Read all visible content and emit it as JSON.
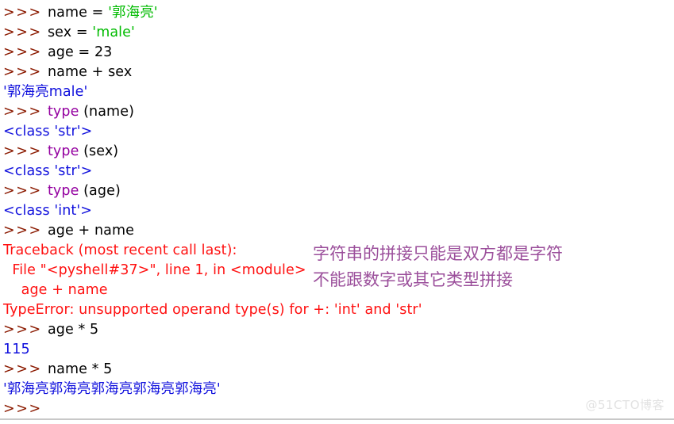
{
  "shell": {
    "app": "Python IDLE Shell",
    "prompt": ">>> ",
    "lines": [
      {
        "id": "l1",
        "kind": "input",
        "prompt": ">>> ",
        "parts": [
          {
            "t": "name = ",
            "c": "plain"
          },
          {
            "t": "'郭海亮'",
            "c": "str"
          }
        ]
      },
      {
        "id": "l2",
        "kind": "input",
        "prompt": ">>> ",
        "parts": [
          {
            "t": "sex = ",
            "c": "plain"
          },
          {
            "t": "'male'",
            "c": "str"
          }
        ]
      },
      {
        "id": "l3",
        "kind": "input",
        "prompt": ">>> ",
        "parts": [
          {
            "t": "age = 23",
            "c": "plain"
          }
        ]
      },
      {
        "id": "l4",
        "kind": "input",
        "prompt": ">>> ",
        "parts": [
          {
            "t": "name + sex",
            "c": "plain"
          }
        ]
      },
      {
        "id": "l5",
        "kind": "output",
        "prompt": "",
        "parts": [
          {
            "t": "'郭海亮male'",
            "c": "out"
          }
        ]
      },
      {
        "id": "l6",
        "kind": "input",
        "prompt": ">>> ",
        "parts": [
          {
            "t": "type",
            "c": "kw"
          },
          {
            "t": " (name)",
            "c": "plain"
          }
        ]
      },
      {
        "id": "l7",
        "kind": "output",
        "prompt": "",
        "parts": [
          {
            "t": "<class 'str'>",
            "c": "out"
          }
        ]
      },
      {
        "id": "l8",
        "kind": "input",
        "prompt": ">>> ",
        "parts": [
          {
            "t": "type",
            "c": "kw"
          },
          {
            "t": " (sex)",
            "c": "plain"
          }
        ]
      },
      {
        "id": "l9",
        "kind": "output",
        "prompt": "",
        "parts": [
          {
            "t": "<class 'str'>",
            "c": "out"
          }
        ]
      },
      {
        "id": "l10",
        "kind": "input",
        "prompt": ">>> ",
        "parts": [
          {
            "t": "type",
            "c": "kw"
          },
          {
            "t": " (age)",
            "c": "plain"
          }
        ]
      },
      {
        "id": "l11",
        "kind": "output",
        "prompt": "",
        "parts": [
          {
            "t": "<class 'int'>",
            "c": "out"
          }
        ]
      },
      {
        "id": "l12",
        "kind": "input",
        "prompt": ">>> ",
        "parts": [
          {
            "t": "age + name",
            "c": "plain"
          }
        ]
      },
      {
        "id": "l13",
        "kind": "error",
        "prompt": "",
        "parts": [
          {
            "t": "Traceback (most recent call last):",
            "c": "err"
          }
        ]
      },
      {
        "id": "l14",
        "kind": "error",
        "prompt": "",
        "parts": [
          {
            "t": "  File \"<pyshell#37>\", line 1, in <module>",
            "c": "err"
          }
        ]
      },
      {
        "id": "l15",
        "kind": "error",
        "prompt": "",
        "parts": [
          {
            "t": "    age + name",
            "c": "err"
          }
        ]
      },
      {
        "id": "l16",
        "kind": "error",
        "prompt": "",
        "parts": [
          {
            "t": "TypeError: unsupported operand type(s) for +: 'int' and 'str'",
            "c": "err"
          }
        ]
      },
      {
        "id": "l17",
        "kind": "input",
        "prompt": ">>> ",
        "parts": [
          {
            "t": "age * 5",
            "c": "plain"
          }
        ]
      },
      {
        "id": "l18",
        "kind": "output",
        "prompt": "",
        "parts": [
          {
            "t": "115",
            "c": "out"
          }
        ]
      },
      {
        "id": "l19",
        "kind": "input",
        "prompt": ">>> ",
        "parts": [
          {
            "t": "name * 5",
            "c": "plain"
          }
        ]
      },
      {
        "id": "l20",
        "kind": "output",
        "prompt": "",
        "parts": [
          {
            "t": "'郭海亮郭海亮郭海亮郭海亮郭海亮'",
            "c": "out"
          }
        ]
      },
      {
        "id": "l21",
        "kind": "input",
        "prompt": ">>> ",
        "parts": []
      }
    ]
  },
  "annotation": {
    "color": "#9b4f9b",
    "lines": [
      "字符串的拼接只能是双方都是字符",
      "不能跟数字或其它类型拼接"
    ]
  },
  "watermark": {
    "text": "@51CTO博客",
    "color": "#e2e2e2"
  },
  "colors": {
    "background": "#ffffff",
    "prompt": "#8b1a00",
    "plain_text": "#000000",
    "source_string": "#00bb00",
    "keyword": "#9400a0",
    "output": "#1111dd",
    "error": "#ff1111",
    "divider": "#c8c8c8"
  }
}
